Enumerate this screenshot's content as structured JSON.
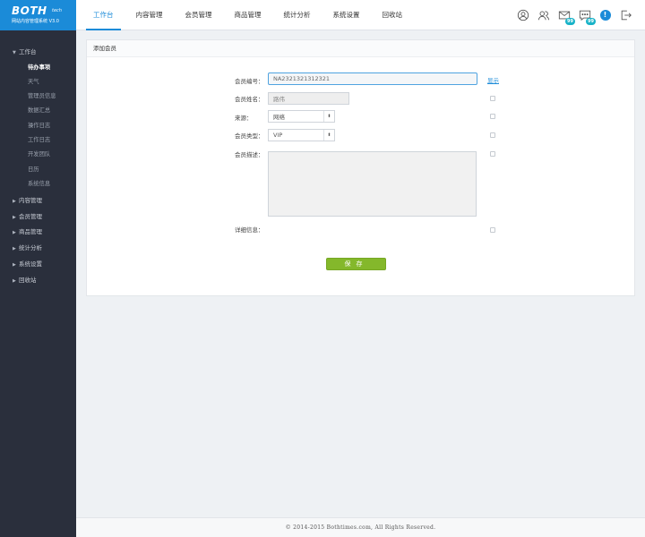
{
  "logo": {
    "main": "BOTH",
    "tech": "tech",
    "subtitle": "网站内容管理系统 V3.0"
  },
  "nav": {
    "items": [
      {
        "label": "工作台",
        "active": true
      },
      {
        "label": "内容管理"
      },
      {
        "label": "会员管理"
      },
      {
        "label": "商品管理"
      },
      {
        "label": "统计分析"
      },
      {
        "label": "系统设置"
      },
      {
        "label": "回收站"
      }
    ]
  },
  "toolbar": {
    "icons": [
      "user-circle-icon",
      "users-icon",
      "mail-icon",
      "chat-icon",
      "alert-icon",
      "logout-icon"
    ],
    "mail_badge": "99",
    "chat_badge": "99",
    "alert_symbol": "!"
  },
  "sidebar": {
    "groups": [
      {
        "label": "工作台",
        "expanded": true,
        "items": [
          "待办事项",
          "天气",
          "管理员信息",
          "数据汇总",
          "操作日志",
          "工作日志",
          "开发团队",
          "日历",
          "系统信息"
        ]
      },
      {
        "label": "内容管理"
      },
      {
        "label": "会员管理"
      },
      {
        "label": "商品管理"
      },
      {
        "label": "统计分析"
      },
      {
        "label": "系统设置"
      },
      {
        "label": "回收站"
      }
    ],
    "active_item": "待办事项"
  },
  "panel": {
    "title": "添加会员",
    "form": {
      "member_id_label": "会员编号：",
      "member_id_value": "NA2321321312321",
      "show_link": "显示",
      "member_name_label": "会员姓名：",
      "member_name_value": "路伟",
      "source_label": "来源：",
      "source_value": "网络",
      "type_label": "会员类型：",
      "type_value": "VIP",
      "desc_label": "会员描述：",
      "detail_label": "详细信息：",
      "save_label": "保存"
    }
  },
  "footer": {
    "text": "© 2014-2015 Bothtimes.com, All Rights Reserved."
  }
}
